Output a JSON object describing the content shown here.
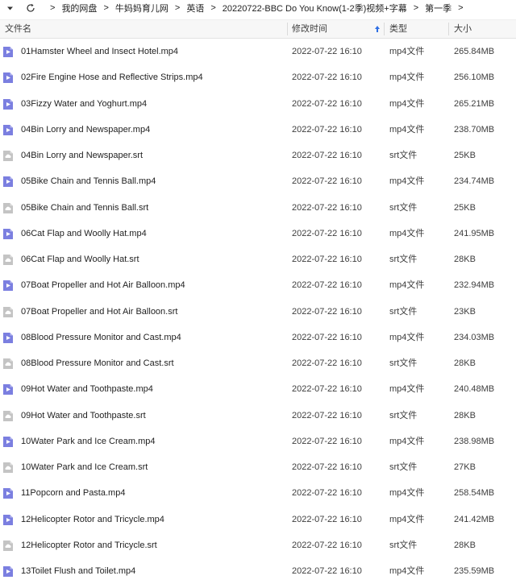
{
  "breadcrumb": {
    "items": [
      "我的网盘",
      "牛妈妈育儿网",
      "英语",
      "20220722-BBC Do You Know(1-2季)视频+字幕",
      "第一季"
    ],
    "separator": ">"
  },
  "columns": {
    "name": "文件名",
    "date": "修改时间",
    "type": "类型",
    "size": "大小"
  },
  "colors": {
    "video_icon": "#7b7fe0",
    "subtitle_icon": "#c4c4c4",
    "sort_arrow": "#2f6fe4"
  },
  "files": [
    {
      "name": "01Hamster Wheel and Insect Hotel.mp4",
      "date": "2022-07-22 16:10",
      "type": "mp4文件",
      "size": "265.84MB",
      "icon": "video-file-icon"
    },
    {
      "name": "02Fire Engine Hose and Reflective Strips.mp4",
      "date": "2022-07-22 16:10",
      "type": "mp4文件",
      "size": "256.10MB",
      "icon": "video-file-icon"
    },
    {
      "name": "03Fizzy Water and Yoghurt.mp4",
      "date": "2022-07-22 16:10",
      "type": "mp4文件",
      "size": "265.21MB",
      "icon": "video-file-icon"
    },
    {
      "name": "04Bin Lorry and Newspaper.mp4",
      "date": "2022-07-22 16:10",
      "type": "mp4文件",
      "size": "238.70MB",
      "icon": "video-file-icon"
    },
    {
      "name": "04Bin Lorry and Newspaper.srt",
      "date": "2022-07-22 16:10",
      "type": "srt文件",
      "size": "25KB",
      "icon": "subtitle-file-icon"
    },
    {
      "name": "05Bike Chain and Tennis Ball.mp4",
      "date": "2022-07-22 16:10",
      "type": "mp4文件",
      "size": "234.74MB",
      "icon": "video-file-icon"
    },
    {
      "name": "05Bike Chain and Tennis Ball.srt",
      "date": "2022-07-22 16:10",
      "type": "srt文件",
      "size": "25KB",
      "icon": "subtitle-file-icon"
    },
    {
      "name": "06Cat Flap and Woolly Hat.mp4",
      "date": "2022-07-22 16:10",
      "type": "mp4文件",
      "size": "241.95MB",
      "icon": "video-file-icon"
    },
    {
      "name": "06Cat Flap and Woolly Hat.srt",
      "date": "2022-07-22 16:10",
      "type": "srt文件",
      "size": "28KB",
      "icon": "subtitle-file-icon"
    },
    {
      "name": "07Boat Propeller and Hot Air Balloon.mp4",
      "date": "2022-07-22 16:10",
      "type": "mp4文件",
      "size": "232.94MB",
      "icon": "video-file-icon"
    },
    {
      "name": "07Boat Propeller and Hot Air Balloon.srt",
      "date": "2022-07-22 16:10",
      "type": "srt文件",
      "size": "23KB",
      "icon": "subtitle-file-icon"
    },
    {
      "name": "08Blood Pressure Monitor and Cast.mp4",
      "date": "2022-07-22 16:10",
      "type": "mp4文件",
      "size": "234.03MB",
      "icon": "video-file-icon"
    },
    {
      "name": "08Blood Pressure Monitor and Cast.srt",
      "date": "2022-07-22 16:10",
      "type": "srt文件",
      "size": "28KB",
      "icon": "subtitle-file-icon"
    },
    {
      "name": "09Hot Water and Toothpaste.mp4",
      "date": "2022-07-22 16:10",
      "type": "mp4文件",
      "size": "240.48MB",
      "icon": "video-file-icon"
    },
    {
      "name": "09Hot Water and Toothpaste.srt",
      "date": "2022-07-22 16:10",
      "type": "srt文件",
      "size": "28KB",
      "icon": "subtitle-file-icon"
    },
    {
      "name": "10Water Park and Ice Cream.mp4",
      "date": "2022-07-22 16:10",
      "type": "mp4文件",
      "size": "238.98MB",
      "icon": "video-file-icon"
    },
    {
      "name": "10Water Park and Ice Cream.srt",
      "date": "2022-07-22 16:10",
      "type": "srt文件",
      "size": "27KB",
      "icon": "subtitle-file-icon"
    },
    {
      "name": "11Popcorn and Pasta.mp4",
      "date": "2022-07-22 16:10",
      "type": "mp4文件",
      "size": "258.54MB",
      "icon": "video-file-icon"
    },
    {
      "name": "12Helicopter Rotor and Tricycle.mp4",
      "date": "2022-07-22 16:10",
      "type": "mp4文件",
      "size": "241.42MB",
      "icon": "video-file-icon"
    },
    {
      "name": "12Helicopter Rotor and Tricycle.srt",
      "date": "2022-07-22 16:10",
      "type": "srt文件",
      "size": "28KB",
      "icon": "subtitle-file-icon"
    },
    {
      "name": "13Toilet Flush and Toilet.mp4",
      "date": "2022-07-22 16:10",
      "type": "mp4文件",
      "size": "235.59MB",
      "icon": "video-file-icon"
    }
  ]
}
